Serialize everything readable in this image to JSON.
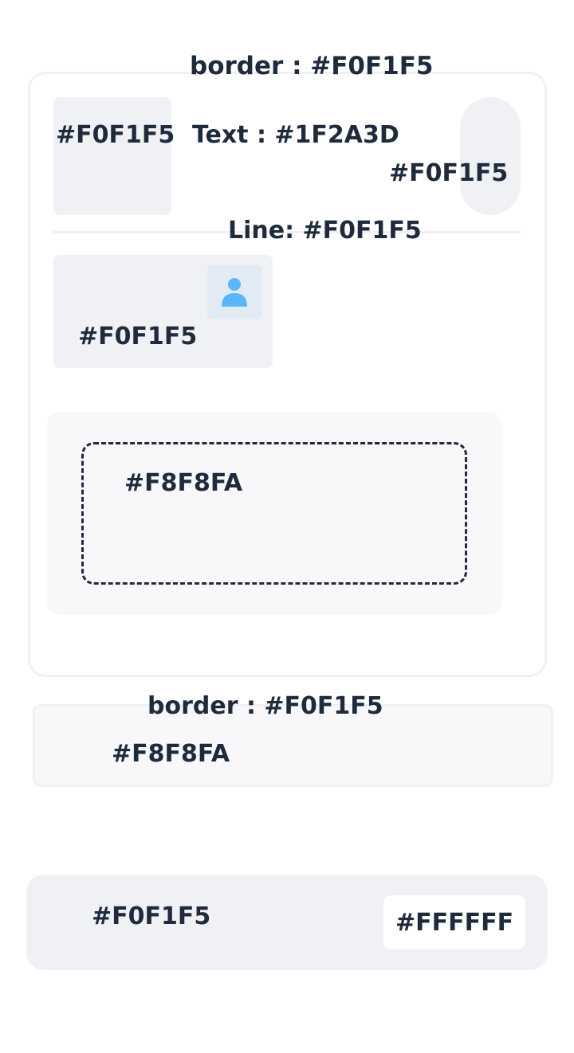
{
  "swatches": {
    "card_border": "border : #F0F1F5",
    "square": "#F0F1F5",
    "text_color": "Text : #1F2A3D",
    "pill": "#F0F1F5",
    "divider": "Line: #F0F1F5",
    "avatar_box": "#F0F1F5",
    "dashed_area": "#F8F8FA",
    "card2_border": "border : #F0F1F5",
    "card2_fill": "#F8F8FA",
    "card3_fill": "#F0F1F5",
    "chip": "#FFFFFF"
  },
  "icons": {
    "avatar": "user-icon"
  },
  "colors": {
    "surface": "#F0F1F5",
    "surface_light": "#F8F8FA",
    "text": "#1F2A3D",
    "white": "#FFFFFF",
    "icon_accent": "#5BB6F8",
    "icon_bg": "#E2EAF4"
  }
}
